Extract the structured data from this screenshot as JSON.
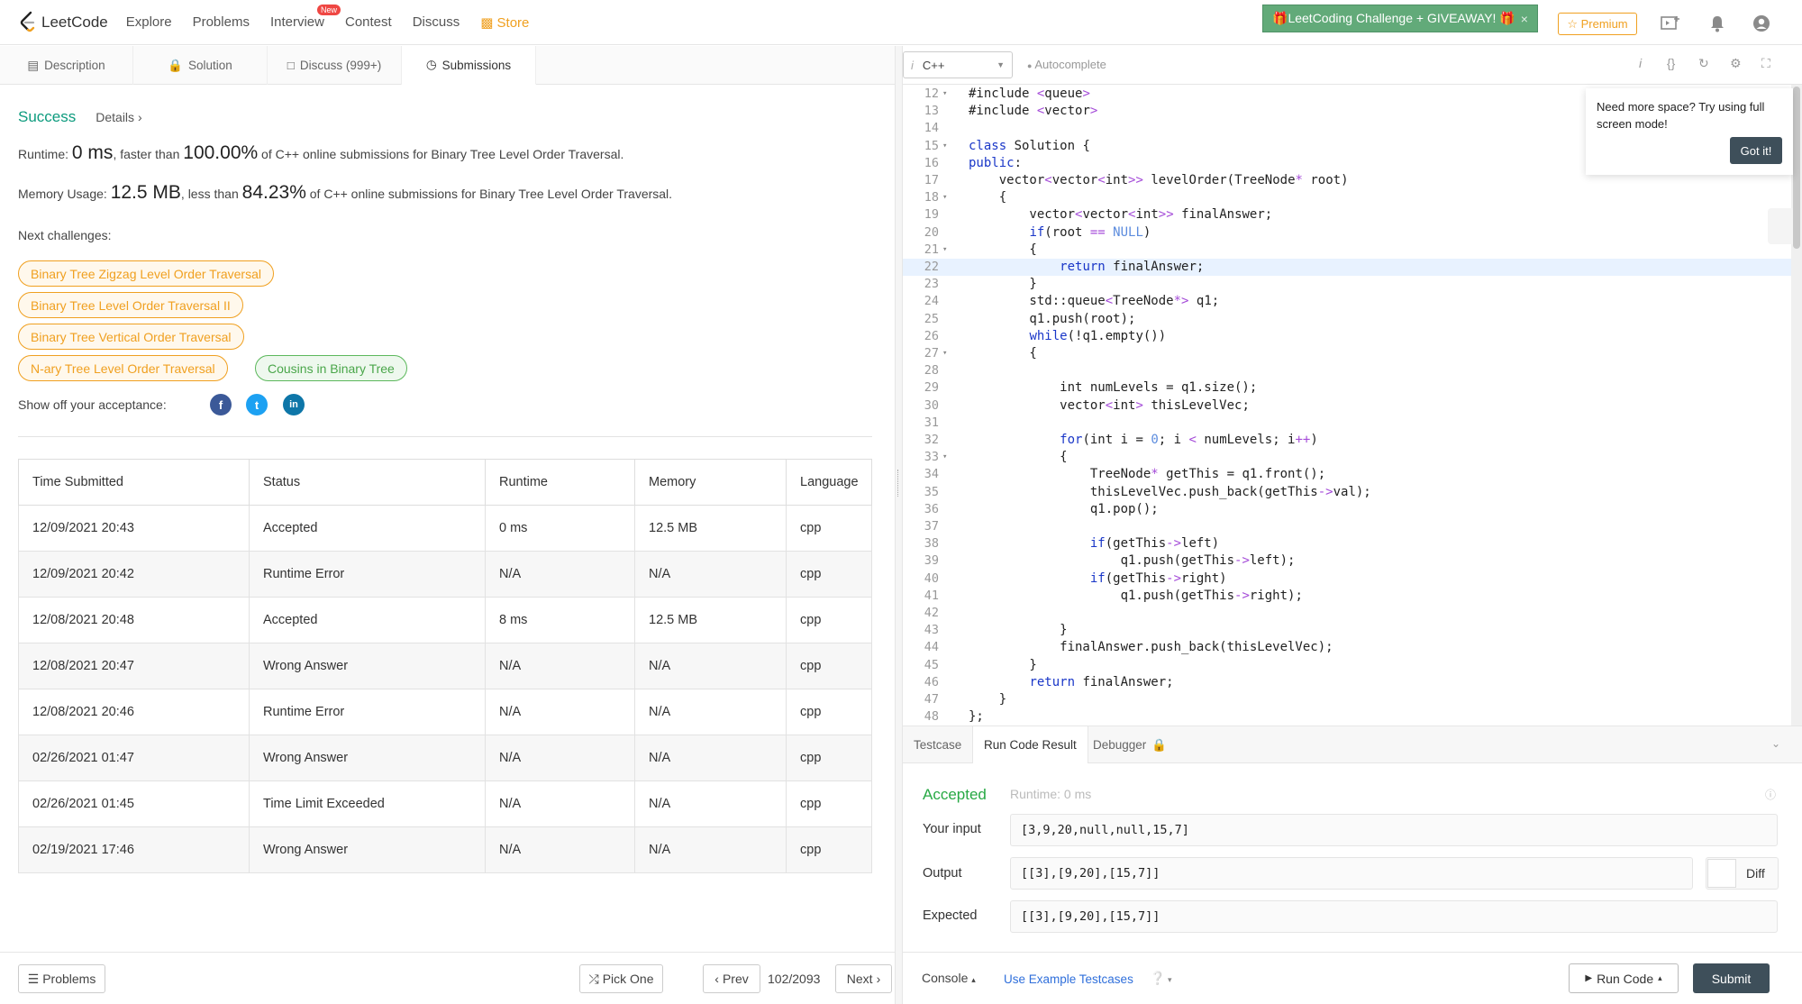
{
  "nav": {
    "logo_text": "LeetCode",
    "links": [
      "Explore",
      "Problems",
      "Interview",
      "Contest",
      "Discuss",
      "Store"
    ],
    "new_badge": "New",
    "promo": "🎁LeetCoding Challenge + GIVEAWAY! 🎁",
    "promo_close": "×",
    "premium": "☆ Premium",
    "accent_color": "#f0a020"
  },
  "tabs": [
    "Description",
    "Solution",
    "Discuss (999+)",
    "Submissions"
  ],
  "result": {
    "status": "Success",
    "details": "Details",
    "runtime_label": "Runtime:",
    "runtime_value": "0 ms",
    "runtime_mid": ", faster than",
    "runtime_pct": "100.00%",
    "runtime_tail": " of C++ online submissions for Binary Tree Level Order Traversal.",
    "memory_label": "Memory Usage:",
    "memory_value": "12.5 MB",
    "memory_mid": ", less than",
    "memory_pct": "84.23%",
    "memory_tail": " of C++ online submissions for Binary Tree Level Order Traversal.",
    "next_label": "Next challenges:",
    "challenges": [
      "Binary Tree Zigzag Level Order Traversal",
      "Binary Tree Level Order Traversal II",
      "Binary Tree Vertical Order Traversal",
      "N-ary Tree Level Order Traversal",
      "Cousins in Binary Tree"
    ],
    "show_off": "Show off your acceptance:",
    "social": [
      "f",
      "t",
      "in"
    ]
  },
  "table": {
    "headers": [
      "Time Submitted",
      "Status",
      "Runtime",
      "Memory",
      "Language"
    ],
    "rows": [
      [
        "12/09/2021 20:43",
        "Accepted",
        "0 ms",
        "12.5 MB",
        "cpp"
      ],
      [
        "12/09/2021 20:42",
        "Runtime Error",
        "N/A",
        "N/A",
        "cpp"
      ],
      [
        "12/08/2021 20:48",
        "Accepted",
        "8 ms",
        "12.5 MB",
        "cpp"
      ],
      [
        "12/08/2021 20:47",
        "Wrong Answer",
        "N/A",
        "N/A",
        "cpp"
      ],
      [
        "12/08/2021 20:46",
        "Runtime Error",
        "N/A",
        "N/A",
        "cpp"
      ],
      [
        "02/26/2021 01:47",
        "Wrong Answer",
        "N/A",
        "N/A",
        "cpp"
      ],
      [
        "02/26/2021 01:45",
        "Time Limit Exceeded",
        "N/A",
        "N/A",
        "cpp"
      ],
      [
        "02/19/2021 17:46",
        "Wrong Answer",
        "N/A",
        "N/A",
        "cpp"
      ]
    ]
  },
  "footer": {
    "problems": "Problems",
    "pick_one": "Pick One",
    "prev": "Prev",
    "page": "102/2093",
    "next": "Next"
  },
  "editor": {
    "language": "C++",
    "autocomplete": "Autocomplete",
    "tooltip": "Need more space? Try using full screen mode!",
    "got_it": "Got it!",
    "code": [
      {
        "n": "12",
        "f": true,
        "t": "#include <queue>"
      },
      {
        "n": "13",
        "f": false,
        "t": "#include <vector>"
      },
      {
        "n": "14",
        "f": false,
        "t": ""
      },
      {
        "n": "15",
        "f": true,
        "t": "class Solution {"
      },
      {
        "n": "16",
        "f": false,
        "t": "public:"
      },
      {
        "n": "17",
        "f": false,
        "t": "    vector<vector<int>> levelOrder(TreeNode* root)"
      },
      {
        "n": "18",
        "f": true,
        "t": "    {"
      },
      {
        "n": "19",
        "f": false,
        "t": "        vector<vector<int>> finalAnswer;"
      },
      {
        "n": "20",
        "f": false,
        "t": "        if(root == NULL)"
      },
      {
        "n": "21",
        "f": true,
        "t": "        {"
      },
      {
        "n": "22",
        "f": false,
        "t": "            return finalAnswer;"
      },
      {
        "n": "23",
        "f": false,
        "t": "        }"
      },
      {
        "n": "24",
        "f": false,
        "t": "        std::queue<TreeNode*> q1;"
      },
      {
        "n": "25",
        "f": false,
        "t": "        q1.push(root);"
      },
      {
        "n": "26",
        "f": false,
        "t": "        while(!q1.empty())"
      },
      {
        "n": "27",
        "f": true,
        "t": "        {"
      },
      {
        "n": "28",
        "f": false,
        "t": ""
      },
      {
        "n": "29",
        "f": false,
        "t": "            int numLevels = q1.size();"
      },
      {
        "n": "30",
        "f": false,
        "t": "            vector<int> thisLevelVec;"
      },
      {
        "n": "31",
        "f": false,
        "t": ""
      },
      {
        "n": "32",
        "f": false,
        "t": "            for(int i = 0; i < numLevels; i++)"
      },
      {
        "n": "33",
        "f": true,
        "t": "            {"
      },
      {
        "n": "34",
        "f": false,
        "t": "                TreeNode* getThis = q1.front();"
      },
      {
        "n": "35",
        "f": false,
        "t": "                thisLevelVec.push_back(getThis->val);"
      },
      {
        "n": "36",
        "f": false,
        "t": "                q1.pop();"
      },
      {
        "n": "37",
        "f": false,
        "t": ""
      },
      {
        "n": "38",
        "f": false,
        "t": "                if(getThis->left)"
      },
      {
        "n": "39",
        "f": false,
        "t": "                    q1.push(getThis->left);"
      },
      {
        "n": "40",
        "f": false,
        "t": "                if(getThis->right)"
      },
      {
        "n": "41",
        "f": false,
        "t": "                    q1.push(getThis->right);"
      },
      {
        "n": "42",
        "f": false,
        "t": ""
      },
      {
        "n": "43",
        "f": false,
        "t": "            }"
      },
      {
        "n": "44",
        "f": false,
        "t": "            finalAnswer.push_back(thisLevelVec);"
      },
      {
        "n": "45",
        "f": false,
        "t": "        }"
      },
      {
        "n": "46",
        "f": false,
        "t": "        return finalAnswer;"
      },
      {
        "n": "47",
        "f": false,
        "t": "    }"
      },
      {
        "n": "48",
        "f": false,
        "t": "};"
      }
    ],
    "highlight_line": "22"
  },
  "run": {
    "tabs": [
      "Testcase",
      "Run Code Result",
      "Debugger"
    ],
    "status": "Accepted",
    "runtime": "Runtime: 0 ms",
    "input_label": "Your input",
    "input": "[3,9,20,null,null,15,7]",
    "output_label": "Output",
    "output": "[[3],[9,20],[15,7]]",
    "expected_label": "Expected",
    "expected": "[[3],[9,20],[15,7]]",
    "diff": "Diff",
    "console": "Console",
    "use_example": "Use Example Testcases",
    "run_code": "Run Code",
    "submit": "Submit"
  }
}
